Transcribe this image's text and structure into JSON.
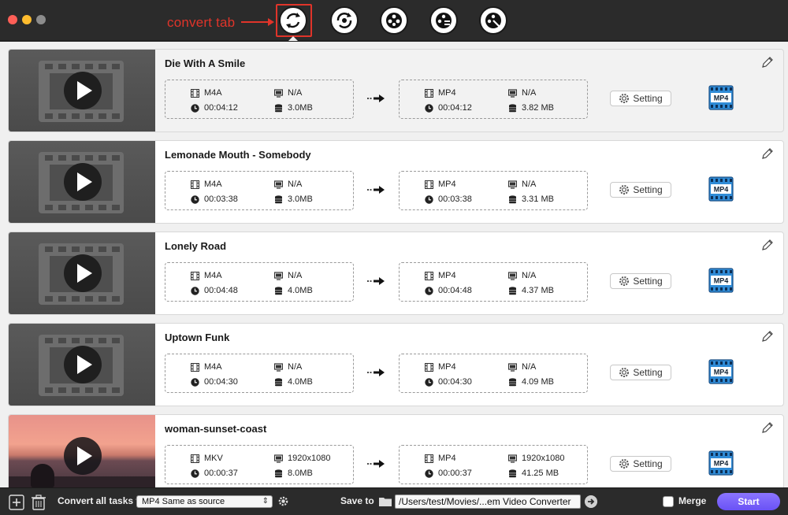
{
  "annotation": {
    "text": "convert tab"
  },
  "toolbar": {
    "buttons": [
      {
        "name": "convert",
        "icon": "convert-icon",
        "active": true
      },
      {
        "name": "download",
        "icon": "download-icon"
      },
      {
        "name": "record",
        "icon": "record-icon"
      },
      {
        "name": "edit",
        "icon": "edit-video-icon"
      },
      {
        "name": "toolbox",
        "icon": "toolbox-icon"
      }
    ]
  },
  "tasks": [
    {
      "title": "Die With A Smile",
      "thumbnail": "film-placeholder",
      "src": {
        "format": "M4A",
        "resolution": "N/A",
        "duration": "00:04:12",
        "size": "3.0MB"
      },
      "dst": {
        "format": "MP4",
        "resolution": "N/A",
        "duration": "00:04:12",
        "size": "3.82 MB"
      },
      "setting_label": "Setting",
      "badge": "MP4"
    },
    {
      "title": "Lemonade Mouth - Somebody",
      "thumbnail": "film-placeholder",
      "src": {
        "format": "M4A",
        "resolution": "N/A",
        "duration": "00:03:38",
        "size": "3.0MB"
      },
      "dst": {
        "format": "MP4",
        "resolution": "N/A",
        "duration": "00:03:38",
        "size": "3.31 MB"
      },
      "setting_label": "Setting",
      "badge": "MP4"
    },
    {
      "title": "Lonely Road",
      "thumbnail": "film-placeholder",
      "src": {
        "format": "M4A",
        "resolution": "N/A",
        "duration": "00:04:48",
        "size": "4.0MB"
      },
      "dst": {
        "format": "MP4",
        "resolution": "N/A",
        "duration": "00:04:48",
        "size": "4.37 MB"
      },
      "setting_label": "Setting",
      "badge": "MP4"
    },
    {
      "title": "Uptown Funk",
      "thumbnail": "film-placeholder",
      "src": {
        "format": "M4A",
        "resolution": "N/A",
        "duration": "00:04:30",
        "size": "4.0MB"
      },
      "dst": {
        "format": "MP4",
        "resolution": "N/A",
        "duration": "00:04:30",
        "size": "4.09 MB"
      },
      "setting_label": "Setting",
      "badge": "MP4"
    },
    {
      "title": "woman-sunset-coast",
      "thumbnail": "sunset-photo",
      "src": {
        "format": "MKV",
        "resolution": "1920x1080",
        "duration": "00:00:37",
        "size": "8.0MB"
      },
      "dst": {
        "format": "MP4",
        "resolution": "1920x1080",
        "duration": "00:00:37",
        "size": "41.25 MB"
      },
      "setting_label": "Setting",
      "badge": "MP4"
    }
  ],
  "bottombar": {
    "convert_all_label": "Convert all tasks to",
    "convert_all_value": "MP4 Same as source",
    "save_to_label": "Save to",
    "save_path": "/Users/test/Movies/...em Video Converter",
    "merge_label": "Merge",
    "merge_checked": false,
    "start_label": "Start"
  },
  "colors": {
    "accent": "#7a63fa",
    "annotation": "#e0342a",
    "badge": "#2f8bd6"
  }
}
